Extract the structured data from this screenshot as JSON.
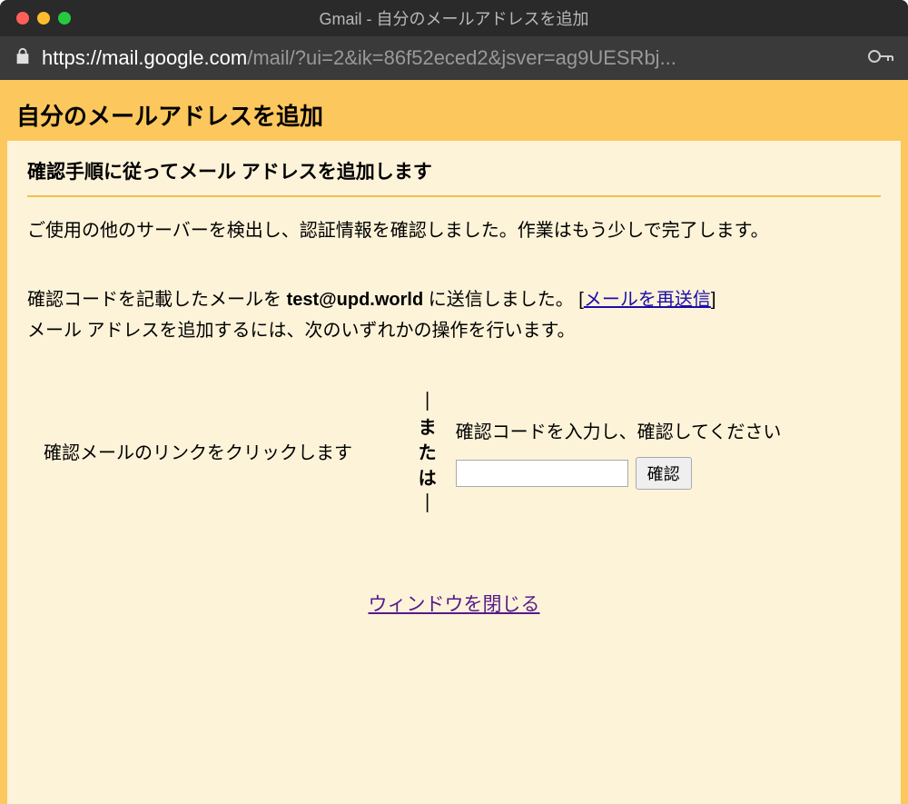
{
  "titlebar": {
    "title": "Gmail - 自分のメールアドレスを追加"
  },
  "urlbar": {
    "host": "https://mail.google.com",
    "path": "/mail/?ui=2&ik=86f52eced2&jsver=ag9UESRbj..."
  },
  "page": {
    "header": "自分のメールアドレスを追加",
    "subheader": "確認手順に従ってメール アドレスを追加します",
    "line1": "ご使用の他のサーバーを検出し、認証情報を確認しました。作業はもう少しで完了します。",
    "line2_pre": "確認コードを記載したメールを ",
    "line2_email": "test@upd.world",
    "line2_post": " に送信しました。 [",
    "line2_link": "メールを再送信",
    "line2_close": "]",
    "line3": "メール アドレスを追加するには、次のいずれかの操作を行います。",
    "left_choice": "確認メールのリンクをクリックします",
    "mid_bar": "｜",
    "mid_ma": "ま",
    "mid_ta": "た",
    "mid_ha": "は",
    "right_choice": "確認コードを入力し、確認してください",
    "confirm_button": "確認",
    "close_link": "ウィンドウを閉じる"
  }
}
